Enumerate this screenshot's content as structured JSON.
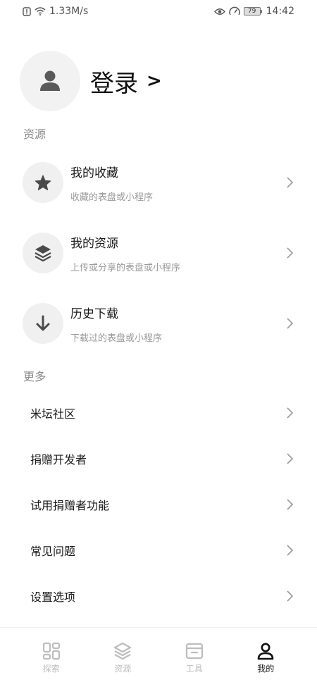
{
  "status_bar": {
    "network_speed": "1.33M/s",
    "battery": "79",
    "time": "14:42"
  },
  "profile": {
    "login_label": "登录",
    "login_arrow": ">"
  },
  "sections": {
    "resources_label": "资源",
    "more_label": "更多"
  },
  "resources": [
    {
      "title": "我的收藏",
      "subtitle": "收藏的表盘或小程序",
      "icon": "star-icon"
    },
    {
      "title": "我的资源",
      "subtitle": "上传或分享的表盘或小程序",
      "icon": "layers-icon"
    },
    {
      "title": "历史下载",
      "subtitle": "下载过的表盘或小程序",
      "icon": "download-icon"
    }
  ],
  "more_items": [
    {
      "title": "米坛社区"
    },
    {
      "title": "捐赠开发者"
    },
    {
      "title": "试用捐赠者功能"
    },
    {
      "title": "常见问题"
    },
    {
      "title": "设置选项"
    }
  ],
  "bottom_nav": [
    {
      "label": "探索",
      "icon": "explore-grid-icon",
      "active": false
    },
    {
      "label": "资源",
      "icon": "layers-icon",
      "active": false
    },
    {
      "label": "工具",
      "icon": "toolbox-icon",
      "active": false
    },
    {
      "label": "我的",
      "icon": "person-icon",
      "active": true
    }
  ],
  "colors": {
    "background": "#ffffff",
    "text_primary": "#1a1a1a",
    "text_secondary": "#999999",
    "icon_circle": "#f0f0f0",
    "nav_inactive": "#bdbdbd",
    "nav_active": "#111111"
  }
}
